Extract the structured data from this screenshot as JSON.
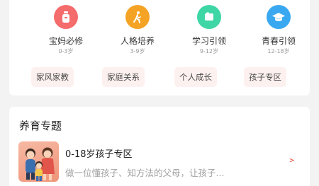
{
  "categories": [
    {
      "name": "宝妈必修",
      "age": "0-3岁",
      "icon": "bottle-icon",
      "color": "#f56c6c"
    },
    {
      "name": "人格培养",
      "age": "3-9岁",
      "icon": "person-walking-icon",
      "color": "#f5a324"
    },
    {
      "name": "学习引领",
      "age": "9-12岁",
      "icon": "card-icon",
      "color": "#3fd6a6"
    },
    {
      "name": "青春引领",
      "age": "12-18岁",
      "icon": "graduation-cap-icon",
      "color": "#3aa8f0"
    }
  ],
  "tags": [
    "家风家教",
    "家庭关系",
    "个人成长",
    "孩子专区"
  ],
  "section": {
    "title": "养育专题",
    "item": {
      "title": "0-18岁孩子专区",
      "desc": "做一位懂孩子、知方法的父母，让孩子...",
      "arrow": ">",
      "thumb_icon": "family-illustration-icon"
    }
  }
}
